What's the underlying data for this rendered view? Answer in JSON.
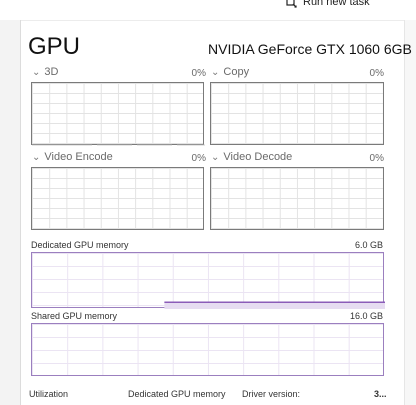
{
  "toolbar": {
    "run_task_label": "Run new task"
  },
  "panel": {
    "title": "GPU",
    "gpu_name": "NVIDIA GeForce GTX 1060 6GB"
  },
  "engines": [
    {
      "label": "3D",
      "percent": "0%"
    },
    {
      "label": "Copy",
      "percent": "0%"
    },
    {
      "label": "Video Encode",
      "percent": "0%"
    },
    {
      "label": "Video Decode",
      "percent": "0%"
    }
  ],
  "dedicated_memory": {
    "label": "Dedicated GPU memory",
    "max": "6.0 GB",
    "usage_fraction_recent": 0.12
  },
  "shared_memory": {
    "label": "Shared GPU memory",
    "max": "16.0 GB"
  },
  "footer": {
    "utilization_label": "Utilization",
    "dedicated_label": "Dedicated GPU memory",
    "driver_label": "Driver version:",
    "driver_value": "3..."
  },
  "colors": {
    "memory_line": "#8b5cb8",
    "memory_border": "#9b7fbf",
    "grid": "#e3e3e3"
  }
}
